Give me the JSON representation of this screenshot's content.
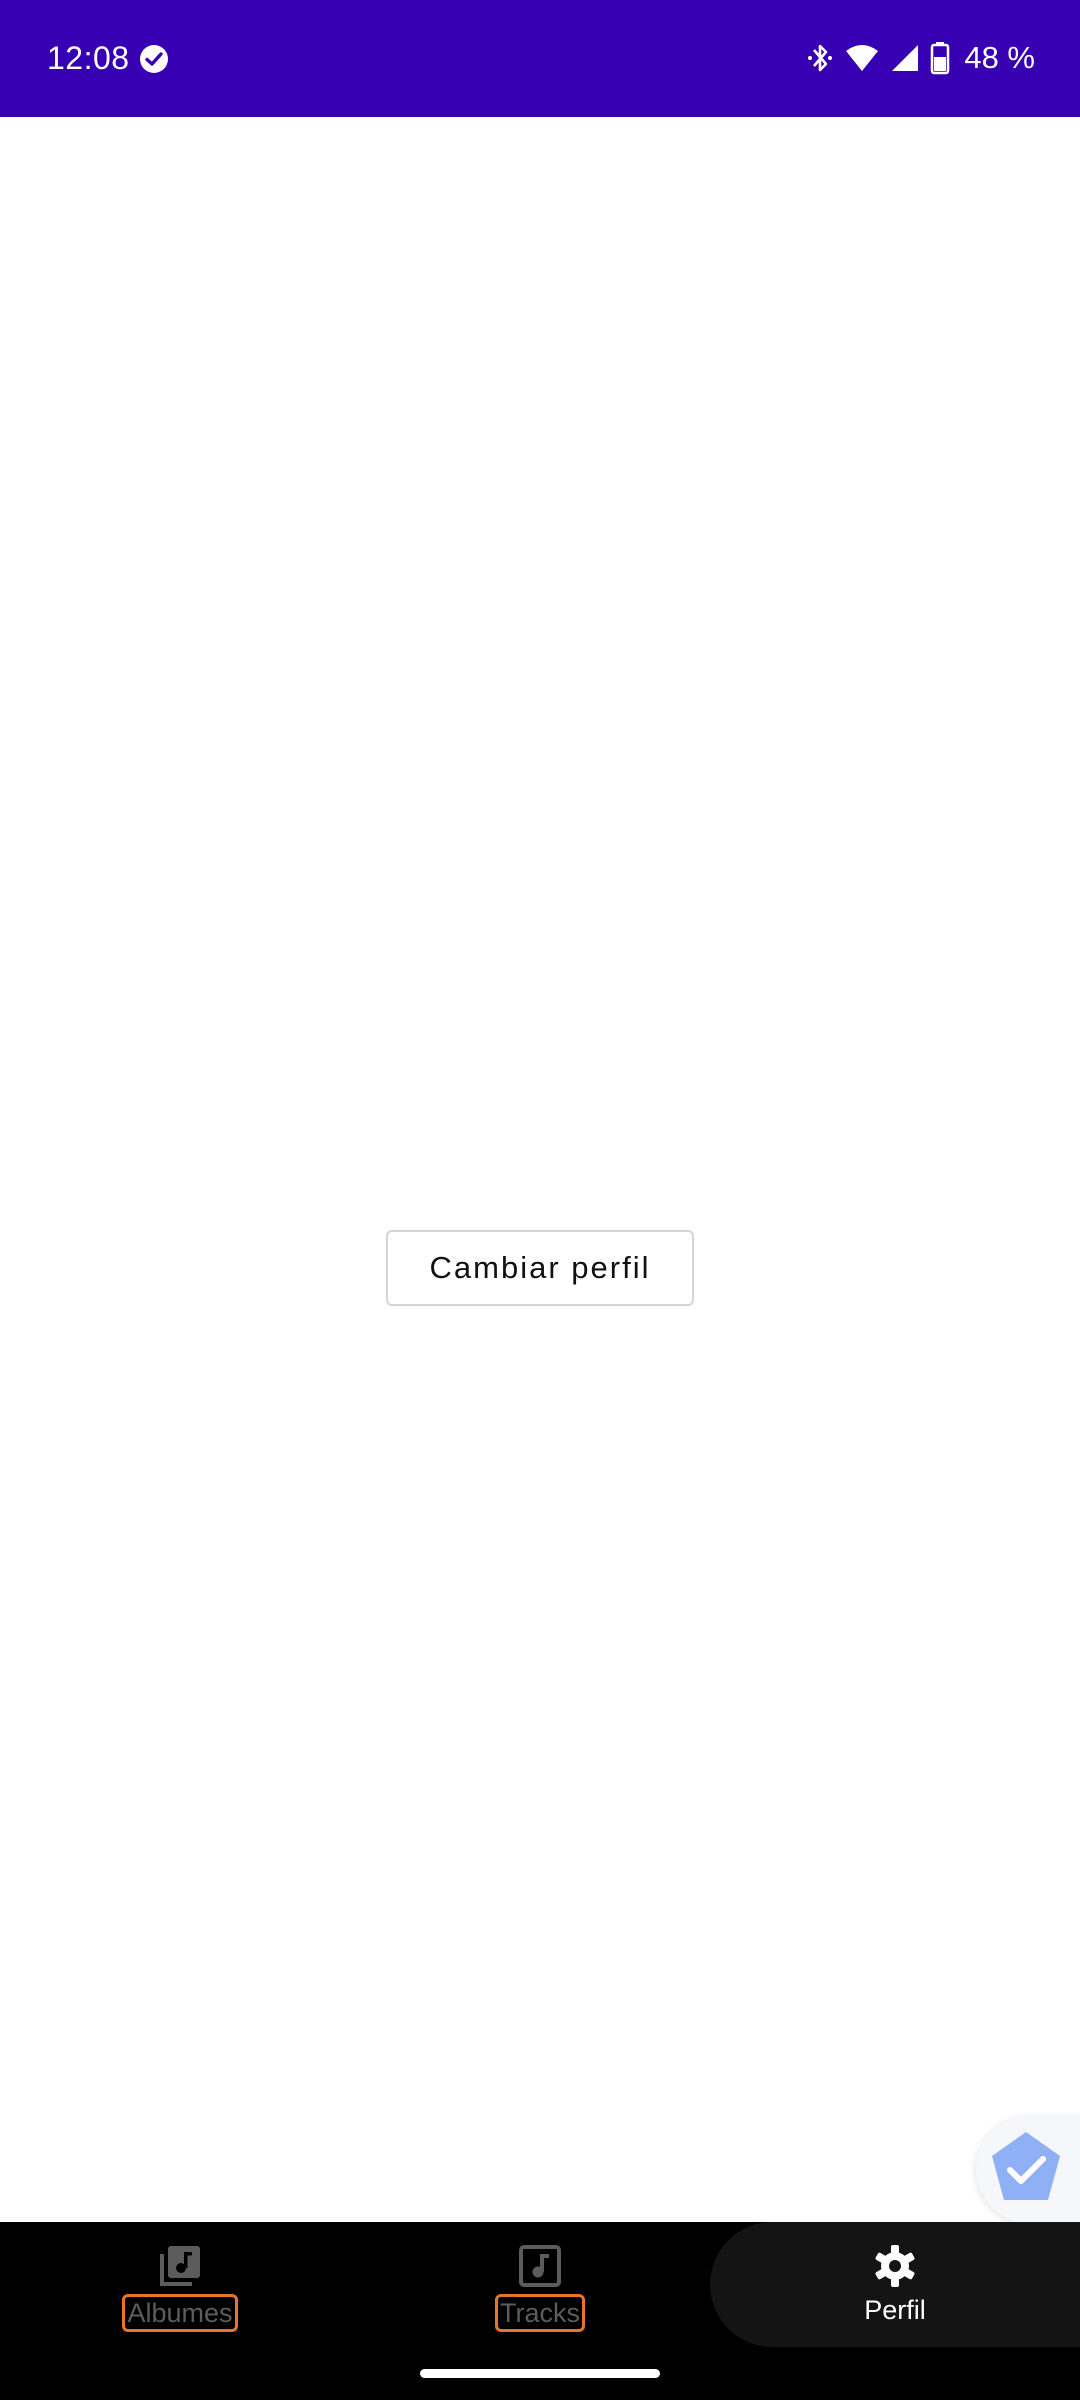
{
  "status_bar": {
    "time": "12:08",
    "battery": "48 %",
    "icons": [
      "check-circle-icon",
      "bluetooth-icon",
      "wifi-icon",
      "signal-icon",
      "battery-icon"
    ],
    "background_color": "#3700B3"
  },
  "main": {
    "change_profile_label": "Cambiar perfil"
  },
  "bottom_nav": {
    "items": [
      {
        "label": "Albumes",
        "icon": "album-library-icon",
        "active": false
      },
      {
        "label": "Tracks",
        "icon": "music-note-icon",
        "active": false
      },
      {
        "label": "Perfil",
        "icon": "gear-icon",
        "active": true
      }
    ],
    "highlight_color": "#e8742a"
  },
  "floating_badge": {
    "icon": "check-shield-icon"
  }
}
